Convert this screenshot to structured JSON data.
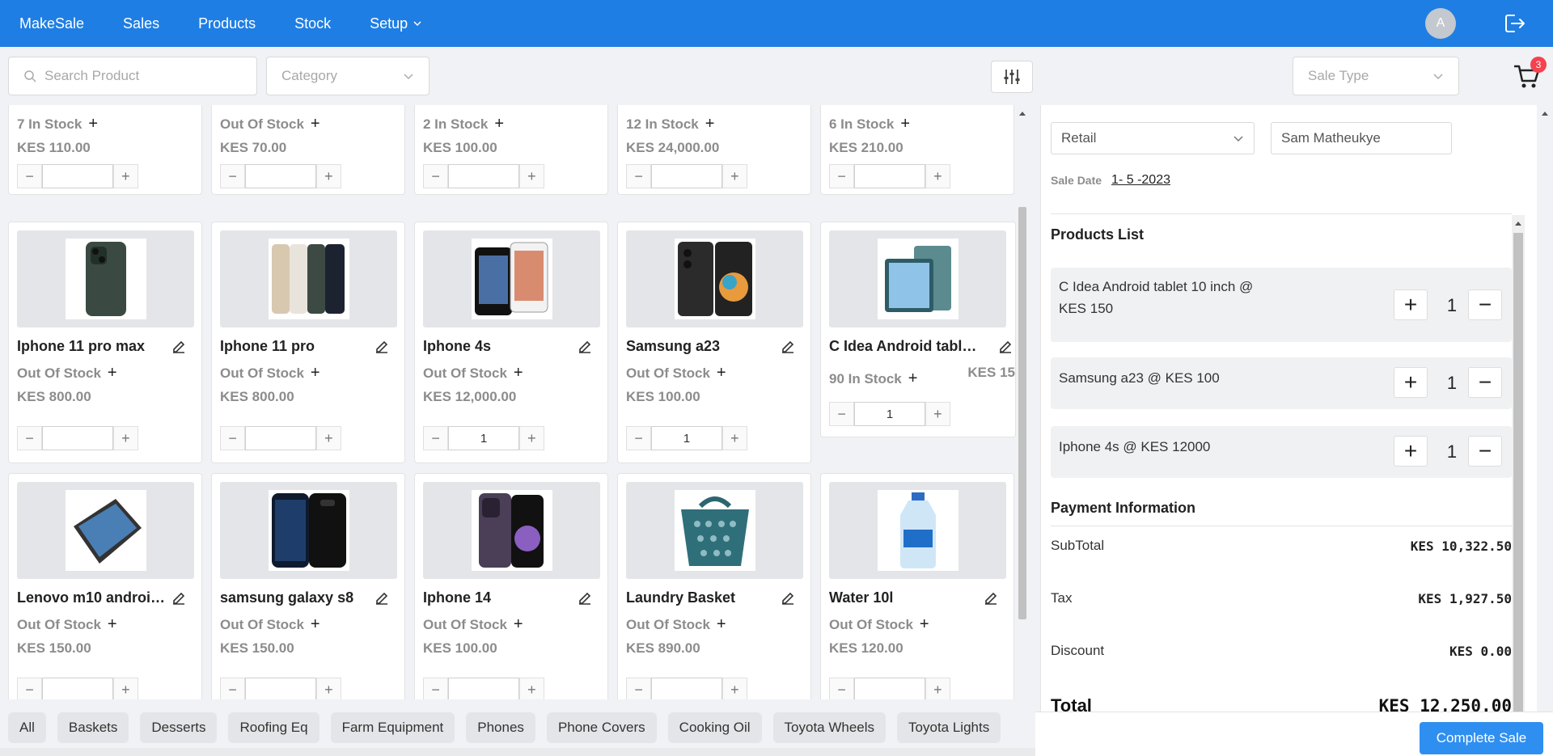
{
  "nav": {
    "items": [
      "MakeSale",
      "Sales",
      "Products",
      "Stock",
      "Setup"
    ],
    "avatar_initial": "A"
  },
  "toolbar": {
    "search_placeholder": "Search Product",
    "category_placeholder": "Category",
    "sale_type_placeholder": "Sale Type",
    "cart_count": "3"
  },
  "products": {
    "row0": [
      {
        "stock": "7 In Stock",
        "price": "KES 110.00",
        "qty": ""
      },
      {
        "stock": "Out Of Stock",
        "price": "KES 70.00",
        "qty": ""
      },
      {
        "stock": "2 In Stock",
        "price": "KES 100.00",
        "qty": ""
      },
      {
        "stock": "12 In Stock",
        "price": "KES 24,000.00",
        "qty": ""
      },
      {
        "stock": "6 In Stock",
        "price": "KES 210.00",
        "qty": ""
      }
    ],
    "row1": [
      {
        "name": "Iphone 11 pro max",
        "stock": "Out Of Stock",
        "price": "KES 800.00",
        "qty": "",
        "icon": "phone-icon"
      },
      {
        "name": "Iphone 11 pro",
        "stock": "Out Of Stock",
        "price": "KES 800.00",
        "qty": "",
        "icon": "phone-icon"
      },
      {
        "name": "Iphone 4s",
        "stock": "Out Of Stock",
        "price": "KES 12,000.00",
        "qty": "1",
        "icon": "phone-icon"
      },
      {
        "name": "Samsung a23",
        "stock": "Out Of Stock",
        "price": "KES 100.00",
        "qty": "1",
        "icon": "phone-icon"
      },
      {
        "name": "C Idea Android tablet ...",
        "stock": "90 In Stock",
        "price": "KES 15",
        "qty": "1",
        "icon": "tablet-icon"
      }
    ],
    "row2": [
      {
        "name": "Lenovo m10 android...",
        "stock": "Out Of Stock",
        "price": "KES 150.00",
        "qty": "",
        "icon": "tablet-icon"
      },
      {
        "name": "samsung galaxy s8",
        "stock": "Out Of Stock",
        "price": "KES 150.00",
        "qty": "",
        "icon": "phone-icon"
      },
      {
        "name": "Iphone 14",
        "stock": "Out Of Stock",
        "price": "KES 100.00",
        "qty": "",
        "icon": "phone-icon"
      },
      {
        "name": "Laundry Basket",
        "stock": "Out Of Stock",
        "price": "KES 890.00",
        "qty": "",
        "icon": "basket-icon"
      },
      {
        "name": "Water 10l",
        "stock": "Out Of Stock",
        "price": "KES 120.00",
        "qty": "",
        "icon": "bottle-icon"
      }
    ]
  },
  "categories": [
    "All",
    "Baskets",
    "Desserts",
    "Roofing Eq",
    "Farm Equipment",
    "Phones",
    "Phone Covers",
    "Cooking Oil",
    "Toyota Wheels",
    "Toyota Lights"
  ],
  "panel": {
    "price_type": "Retail",
    "customer": "Sam Matheukye",
    "sale_date_label": "Sale Date",
    "sale_date": "1- 5 -2023",
    "products_list_title": "Products List",
    "items": [
      {
        "label": "C Idea Android tablet 10 inch @ KES 150",
        "qty": "1"
      },
      {
        "label": "Samsung a23 @ KES 100",
        "qty": "1"
      },
      {
        "label": "Iphone 4s @ KES 12000",
        "qty": "1"
      }
    ],
    "payment_title": "Payment Information",
    "subtotal_label": "SubTotal",
    "subtotal": "KES 10,322.50",
    "tax_label": "Tax",
    "tax": "KES 1,927.50",
    "discount_label": "Discount",
    "discount": "KES 0.00",
    "total_label": "Total",
    "total": "KES 12,250.00",
    "complete_label": "Complete Sale"
  },
  "colors": {
    "brand": "#1f7ee3",
    "button": "#2f8ff0",
    "badge": "#f5424e"
  }
}
